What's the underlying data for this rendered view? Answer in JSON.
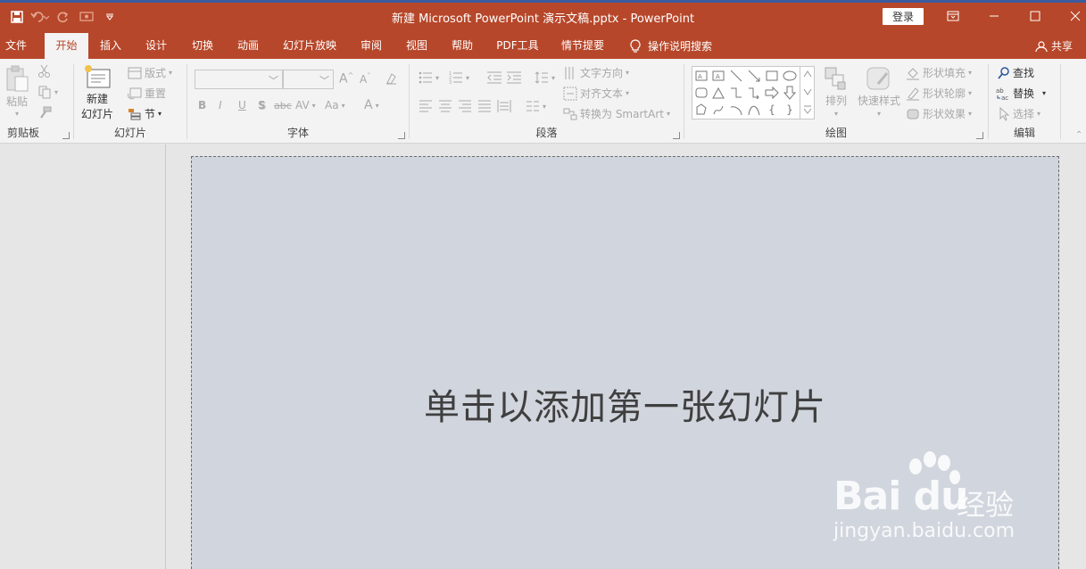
{
  "window": {
    "title": "新建 Microsoft PowerPoint 演示文稿.pptx  -  PowerPoint",
    "login_label": "登录",
    "accent": "#b7472a"
  },
  "quick_access": [
    "save-icon",
    "undo-icon",
    "redo-icon",
    "presenter-icon",
    "customize-icon"
  ],
  "tabs": [
    {
      "label": "文件"
    },
    {
      "label": "开始",
      "active": true
    },
    {
      "label": "插入"
    },
    {
      "label": "设计"
    },
    {
      "label": "切换"
    },
    {
      "label": "动画"
    },
    {
      "label": "幻灯片放映"
    },
    {
      "label": "审阅"
    },
    {
      "label": "视图"
    },
    {
      "label": "帮助"
    },
    {
      "label": "PDF工具"
    },
    {
      "label": "情节提要"
    }
  ],
  "tell_me": "操作说明搜索",
  "share": "共享",
  "ribbon": {
    "clipboard": {
      "label": "剪贴板",
      "paste": "粘贴"
    },
    "slides": {
      "label": "幻灯片",
      "new_slide_1": "新建",
      "new_slide_2": "幻灯片",
      "layout": "版式",
      "reset": "重置",
      "section": "节"
    },
    "font": {
      "label": "字体",
      "font_name": "",
      "font_size": ""
    },
    "paragraph": {
      "label": "段落",
      "text_direction": "文字方向",
      "align_text": "对齐文本",
      "smartart": "转换为 SmartArt"
    },
    "drawing": {
      "label": "绘图",
      "arrange": "排列",
      "quick_styles": "快速样式",
      "shape_fill": "形状填充",
      "shape_outline": "形状轮廓",
      "shape_effects": "形状效果"
    },
    "editing": {
      "label": "编辑",
      "find": "查找",
      "replace": "替换",
      "select": "选择"
    }
  },
  "slide": {
    "prompt": "单击以添加第一张幻灯片"
  },
  "watermark": {
    "brand": "Bai du",
    "experience": "经验",
    "url": "jingyan.baidu.com"
  }
}
